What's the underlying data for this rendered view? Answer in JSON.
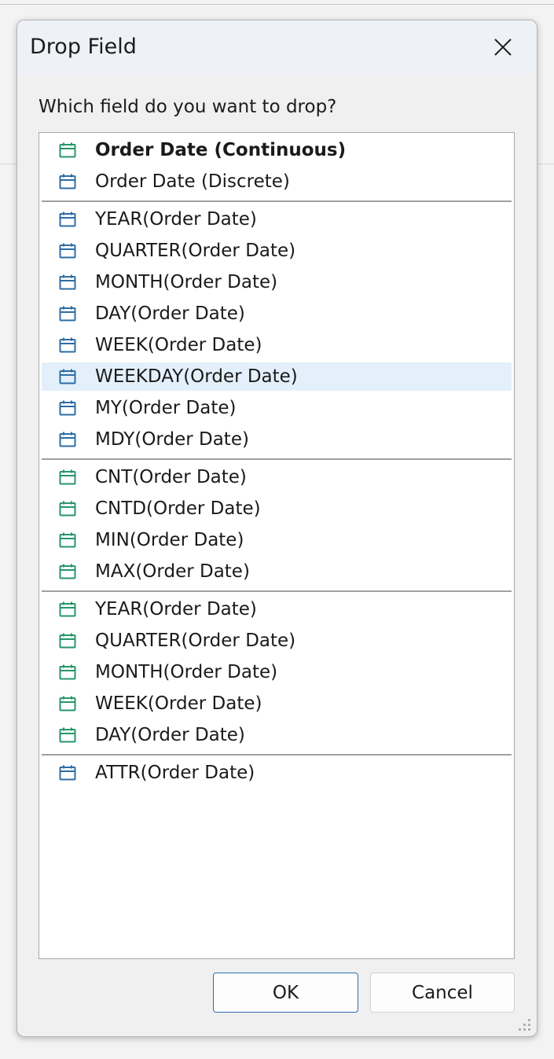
{
  "dialog": {
    "title": "Drop Field",
    "prompt": "Which field do you want to drop?",
    "ok_label": "OK",
    "cancel_label": "Cancel"
  },
  "colors": {
    "discrete_icon": "#2d6da4",
    "continuous_icon": "#27966b",
    "selected_row": "#e3f0fb",
    "ok_border": "#2a6db2"
  },
  "groups": [
    {
      "items": [
        {
          "label": "Order Date (Continuous)",
          "icon": "calendar-continuous-icon",
          "bold": true
        },
        {
          "label": "Order Date (Discrete)",
          "icon": "calendar-discrete-icon"
        }
      ]
    },
    {
      "items": [
        {
          "label": "YEAR(Order Date)",
          "icon": "calendar-discrete-icon"
        },
        {
          "label": "QUARTER(Order Date)",
          "icon": "calendar-discrete-icon"
        },
        {
          "label": "MONTH(Order Date)",
          "icon": "calendar-discrete-icon"
        },
        {
          "label": "DAY(Order Date)",
          "icon": "calendar-discrete-icon"
        },
        {
          "label": "WEEK(Order Date)",
          "icon": "calendar-discrete-icon"
        },
        {
          "label": "WEEKDAY(Order Date)",
          "icon": "calendar-discrete-icon",
          "selected": true
        },
        {
          "label": "MY(Order Date)",
          "icon": "calendar-discrete-icon"
        },
        {
          "label": "MDY(Order Date)",
          "icon": "calendar-discrete-icon"
        }
      ]
    },
    {
      "items": [
        {
          "label": "CNT(Order Date)",
          "icon": "calendar-continuous-icon"
        },
        {
          "label": "CNTD(Order Date)",
          "icon": "calendar-continuous-icon"
        },
        {
          "label": "MIN(Order Date)",
          "icon": "calendar-continuous-icon"
        },
        {
          "label": "MAX(Order Date)",
          "icon": "calendar-continuous-icon"
        }
      ]
    },
    {
      "items": [
        {
          "label": "YEAR(Order Date)",
          "icon": "calendar-continuous-icon"
        },
        {
          "label": "QUARTER(Order Date)",
          "icon": "calendar-continuous-icon"
        },
        {
          "label": "MONTH(Order Date)",
          "icon": "calendar-continuous-icon"
        },
        {
          "label": "WEEK(Order Date)",
          "icon": "calendar-continuous-icon"
        },
        {
          "label": "DAY(Order Date)",
          "icon": "calendar-continuous-icon"
        }
      ]
    },
    {
      "items": [
        {
          "label": "ATTR(Order Date)",
          "icon": "calendar-discrete-icon"
        }
      ]
    }
  ]
}
